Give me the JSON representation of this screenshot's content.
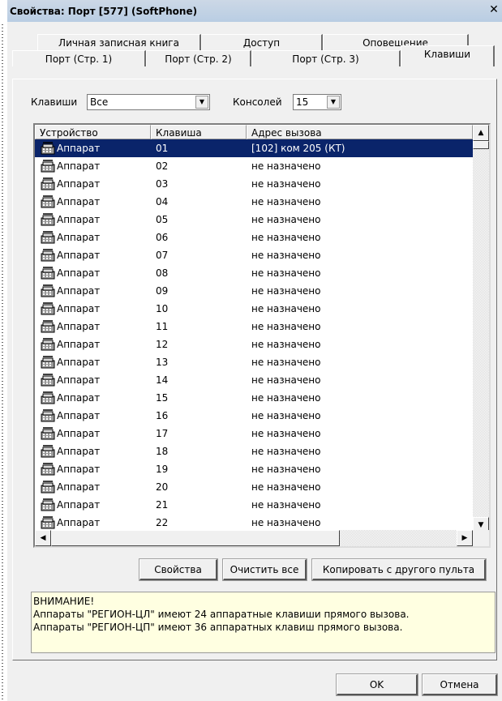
{
  "window": {
    "title": "Свойства: Порт [577] (SoftPhone)",
    "close_glyph": "✕"
  },
  "tabs": {
    "row1": [
      "Личная записная книга",
      "Доступ",
      "Оповещение"
    ],
    "row2": [
      "Порт (Стр. 1)",
      "Порт (Стр. 2)",
      "Порт (Стр. 3)",
      "Клавиши"
    ],
    "active": "Клавиши"
  },
  "filters": {
    "keys_label": "Клавиши",
    "keys_value": "Все",
    "consoles_label": "Консолей",
    "consoles_value": "15"
  },
  "table": {
    "columns": [
      "Устройство",
      "Клавиша",
      "Адрес вызова"
    ],
    "rows": [
      {
        "device": "Аппарат",
        "key": "01",
        "address": "[102] ком 205 (КТ)",
        "selected": true
      },
      {
        "device": "Аппарат",
        "key": "02",
        "address": "не назначено"
      },
      {
        "device": "Аппарат",
        "key": "03",
        "address": "не назначено"
      },
      {
        "device": "Аппарат",
        "key": "04",
        "address": "не назначено"
      },
      {
        "device": "Аппарат",
        "key": "05",
        "address": "не назначено"
      },
      {
        "device": "Аппарат",
        "key": "06",
        "address": "не назначено"
      },
      {
        "device": "Аппарат",
        "key": "07",
        "address": "не назначено"
      },
      {
        "device": "Аппарат",
        "key": "08",
        "address": "не назначено"
      },
      {
        "device": "Аппарат",
        "key": "09",
        "address": "не назначено"
      },
      {
        "device": "Аппарат",
        "key": "10",
        "address": "не назначено"
      },
      {
        "device": "Аппарат",
        "key": "11",
        "address": "не назначено"
      },
      {
        "device": "Аппарат",
        "key": "12",
        "address": "не назначено"
      },
      {
        "device": "Аппарат",
        "key": "13",
        "address": "не назначено"
      },
      {
        "device": "Аппарат",
        "key": "14",
        "address": "не назначено"
      },
      {
        "device": "Аппарат",
        "key": "15",
        "address": "не назначено"
      },
      {
        "device": "Аппарат",
        "key": "16",
        "address": "не назначено"
      },
      {
        "device": "Аппарат",
        "key": "17",
        "address": "не назначено"
      },
      {
        "device": "Аппарат",
        "key": "18",
        "address": "не назначено"
      },
      {
        "device": "Аппарат",
        "key": "19",
        "address": "не назначено"
      },
      {
        "device": "Аппарат",
        "key": "20",
        "address": "не назначено"
      },
      {
        "device": "Аппарат",
        "key": "21",
        "address": "не назначено"
      },
      {
        "device": "Аппарат",
        "key": "22",
        "address": "не назначено"
      }
    ],
    "device_icon": "telephone-icon",
    "selected_color": "#0a246a"
  },
  "actions": {
    "properties": "Свойства",
    "clear_all": "Очистить все",
    "copy_from": "Копировать с другого пульта"
  },
  "note": {
    "heading": "ВНИМАНИЕ!",
    "line1": "Аппараты \"РЕГИОН-ЦЛ\" имеют 24 аппаратные клавиши прямого вызова.",
    "line2": "Аппараты \"РЕГИОН-ЦП\" имеют 36 аппаратных клавиш прямого вызова.",
    "background": "#ffffe1"
  },
  "footer": {
    "ok": "OK",
    "cancel": "Отмена"
  }
}
